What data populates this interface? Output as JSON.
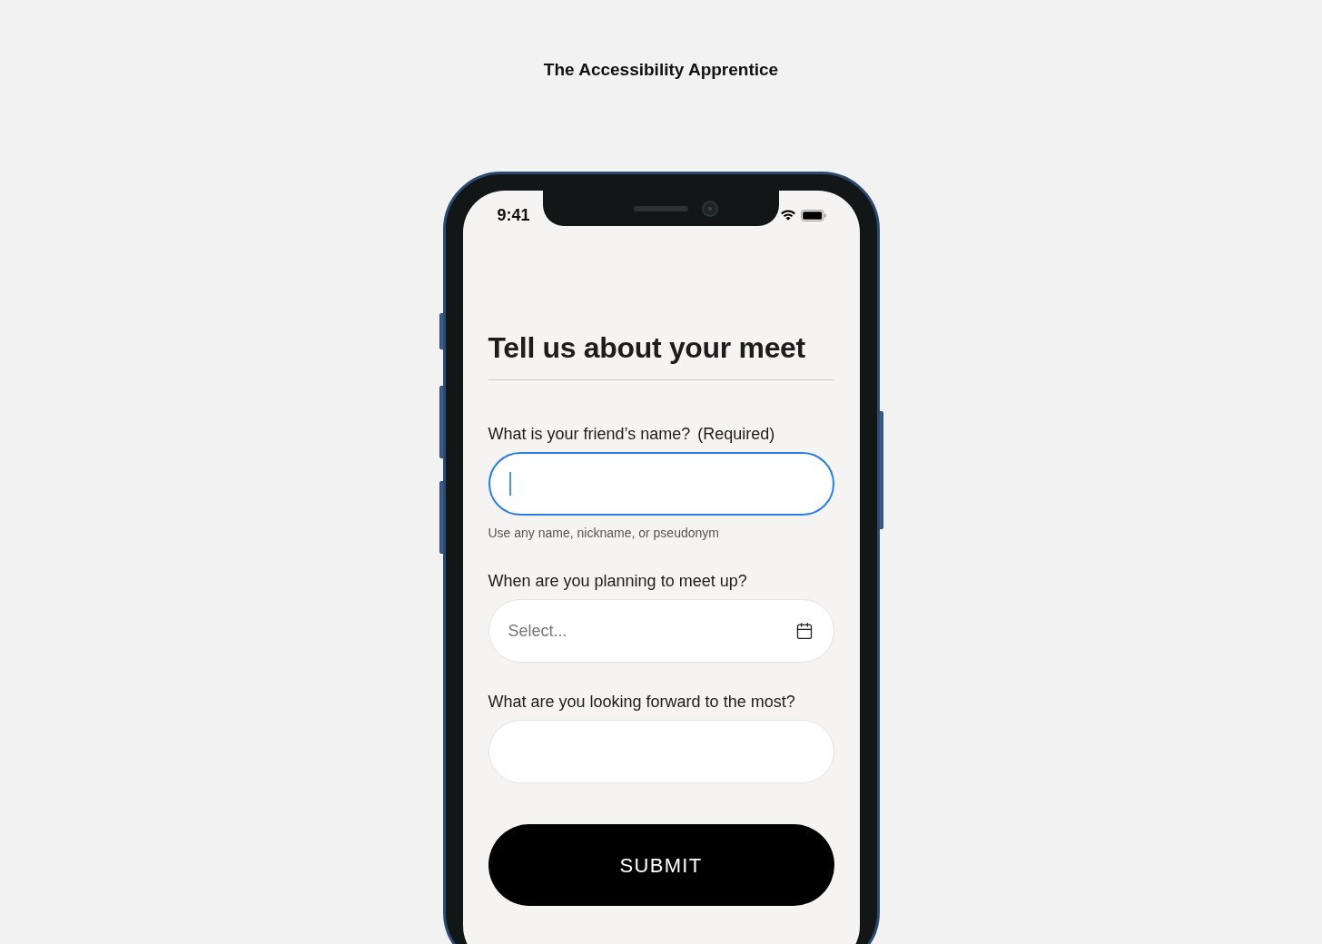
{
  "page": {
    "title": "The Accessibility Apprentice"
  },
  "status_bar": {
    "time": "9:41"
  },
  "form": {
    "heading": "Tell us about your meet",
    "fields": [
      {
        "kind": "text",
        "label": "What is your friend’s name?",
        "required_note": "(Required)",
        "focused": true,
        "hint": "Use any name, nickname, or pseudonym"
      },
      {
        "kind": "date",
        "label": "When are you planning to meet up?",
        "placeholder": "Select...",
        "focused": false
      },
      {
        "kind": "text",
        "label": "What are you looking forward to the most?",
        "focused": false
      }
    ],
    "submit": "SUBMIT"
  }
}
